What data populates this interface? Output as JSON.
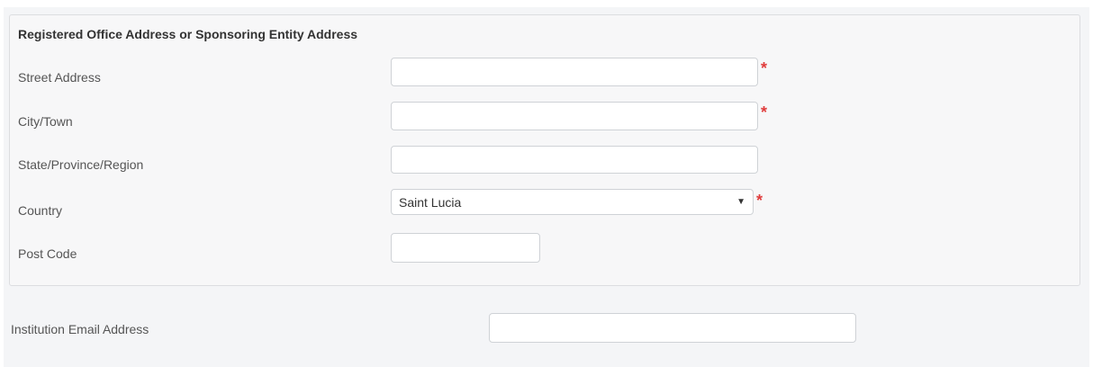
{
  "section": {
    "title": "Registered Office Address or Sponsoring Entity Address"
  },
  "fields": {
    "street_address": {
      "label": "Street Address",
      "value": "",
      "required_mark": "*"
    },
    "city_town": {
      "label": "City/Town",
      "value": "",
      "required_mark": "*"
    },
    "state_province_region": {
      "label": "State/Province/Region",
      "value": ""
    },
    "country": {
      "label": "Country",
      "selected": "Saint Lucia",
      "required_mark": "*"
    },
    "post_code": {
      "label": "Post Code",
      "value": ""
    }
  },
  "institution_email": {
    "label": "Institution Email Address",
    "value": ""
  },
  "icons": {
    "dropdown": "chevron-down-icon"
  },
  "colors": {
    "required": "#e03c3c",
    "border": "#cfd2d6",
    "panel_bg": "#f7f7f8"
  }
}
